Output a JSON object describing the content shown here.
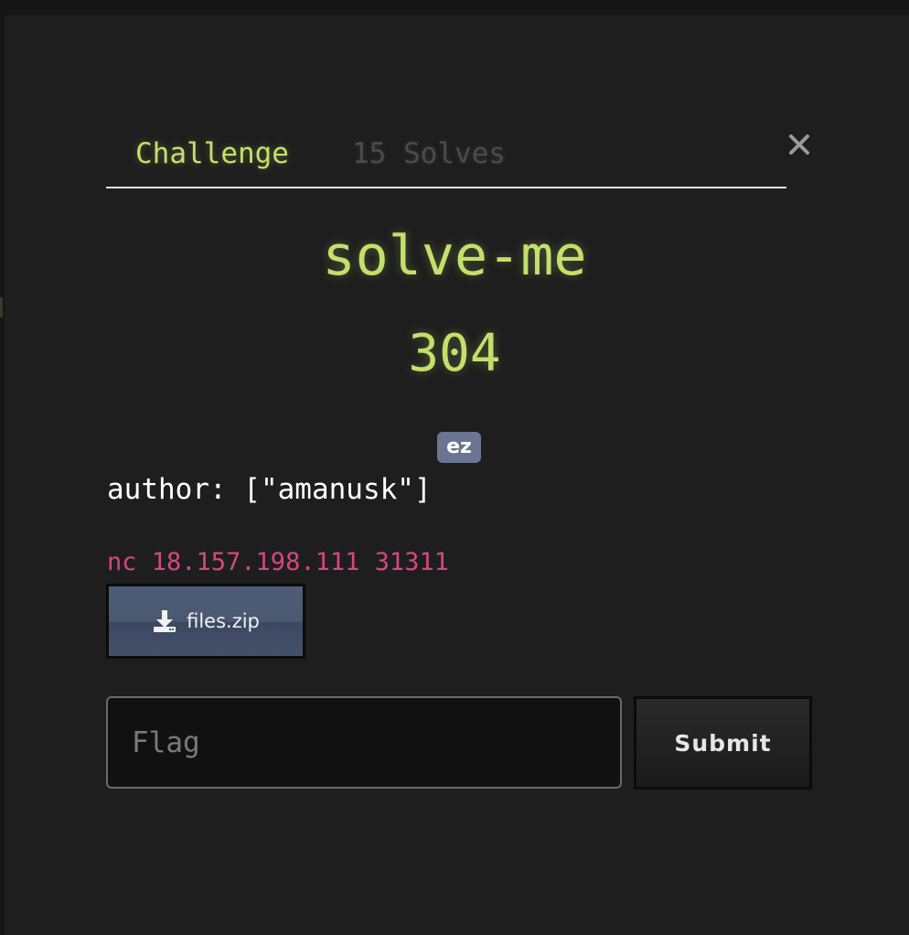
{
  "modal": {
    "tabs": [
      {
        "label": "Challenge",
        "active": true
      },
      {
        "label": "15 Solves",
        "active": false
      }
    ],
    "close_icon": "close-x-icon",
    "challenge": {
      "name": "solve-me",
      "value": "304",
      "tag": "ez",
      "description": "author: [\"amanusk\"]",
      "connection": "nc 18.157.198.111 31311",
      "files": [
        {
          "label": "files.zip",
          "icon": "download-icon"
        }
      ]
    },
    "submission": {
      "placeholder": "Flag",
      "value": "",
      "submit_label": "Submit"
    }
  },
  "colors": {
    "accent": "#c3e06b",
    "connection": "#d6477f",
    "tag_bg": "#6a7592",
    "background": "#1e1e1e"
  }
}
